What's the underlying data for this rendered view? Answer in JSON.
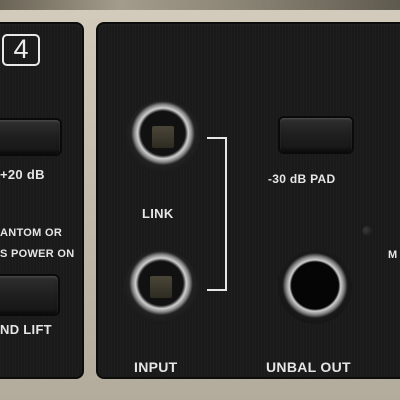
{
  "left_panel": {
    "channel_number": "4",
    "boost_label": "+20 dB",
    "phantom_label_1": "ANTOM OR",
    "phantom_label_2": "S POWER ON",
    "ground_lift_label": "ND LIFT"
  },
  "right_panel": {
    "link_label": "LINK",
    "input_label": "INPUT",
    "pad_label": "-30 dB PAD",
    "unbal_out_label": "UNBAL OUT",
    "edge_label": "M"
  }
}
